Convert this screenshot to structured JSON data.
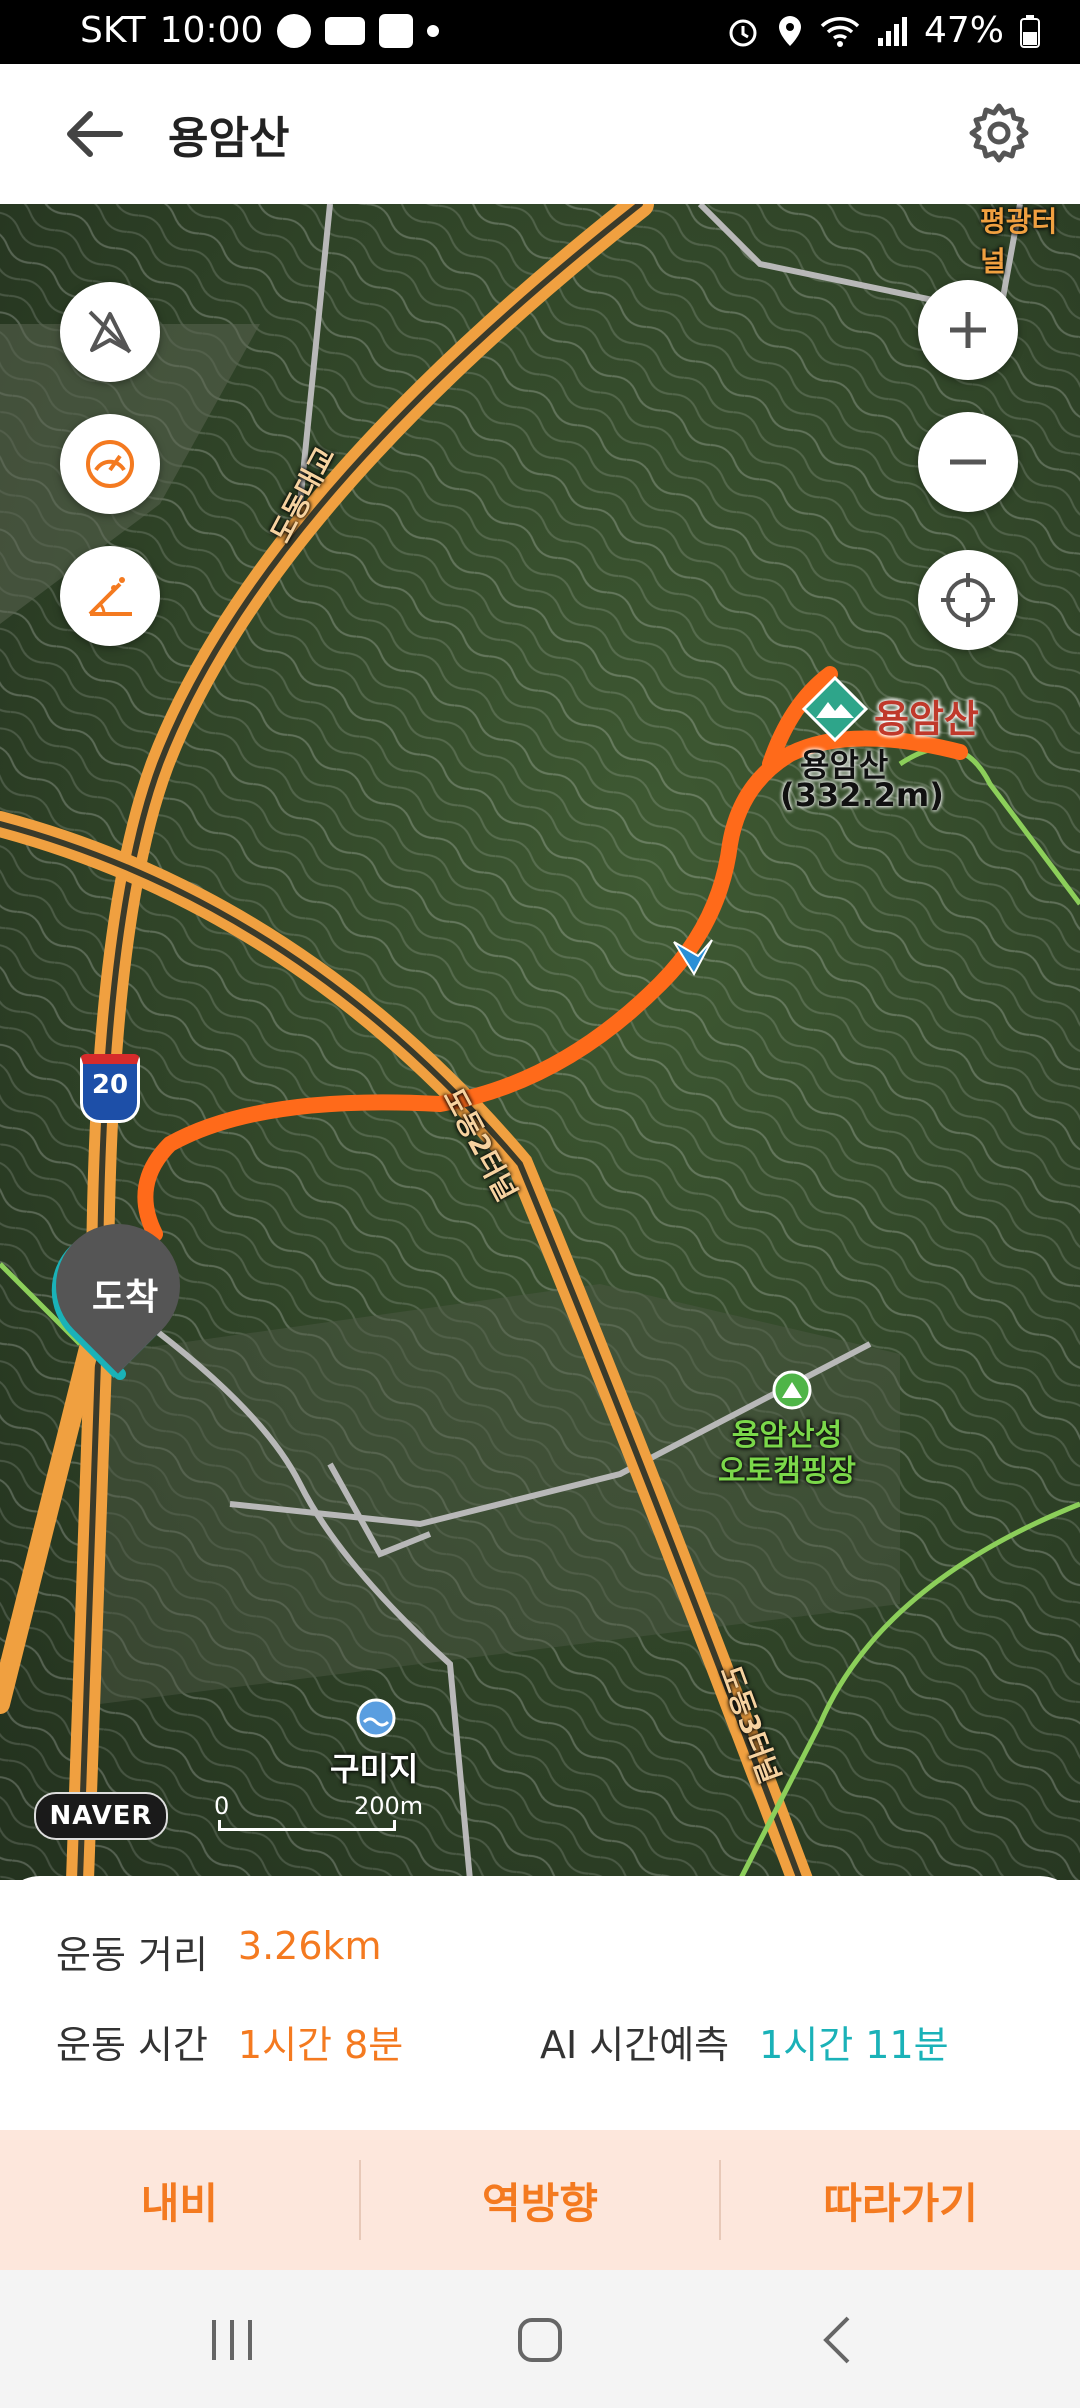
{
  "status_bar": {
    "carrier": "SKT",
    "time": "10:00",
    "battery": "47%"
  },
  "header": {
    "title": "용암산"
  },
  "map": {
    "labels": {
      "summit_name": "용암산",
      "summit_sub": "용암산",
      "summit_elev": "(332.2m)",
      "campground_line1": "용암산성",
      "campground_line2": "오토캠핑장",
      "pond": "구미지",
      "road_bridge": "도동대교",
      "tunnel2": "도동2터널",
      "tunnel3": "도동3터널",
      "tunnel_top": "평광터널",
      "highway_no": "20",
      "arrival": "도착",
      "brand": "NAVER",
      "scale_zero": "0",
      "scale_dist": "200m"
    }
  },
  "stats": {
    "distance_label": "운동 거리",
    "distance_value": "3.26km",
    "time_label": "운동 시간",
    "time_value": "1시간 8분",
    "ai_label": "AI 시간예측",
    "ai_value": "1시간 11분"
  },
  "actions": {
    "navi": "내비",
    "reverse": "역방향",
    "follow": "따라가기"
  },
  "colors": {
    "accent": "#f47a20",
    "teal": "#1ab2b8",
    "action_bg": "#fde7dc"
  }
}
